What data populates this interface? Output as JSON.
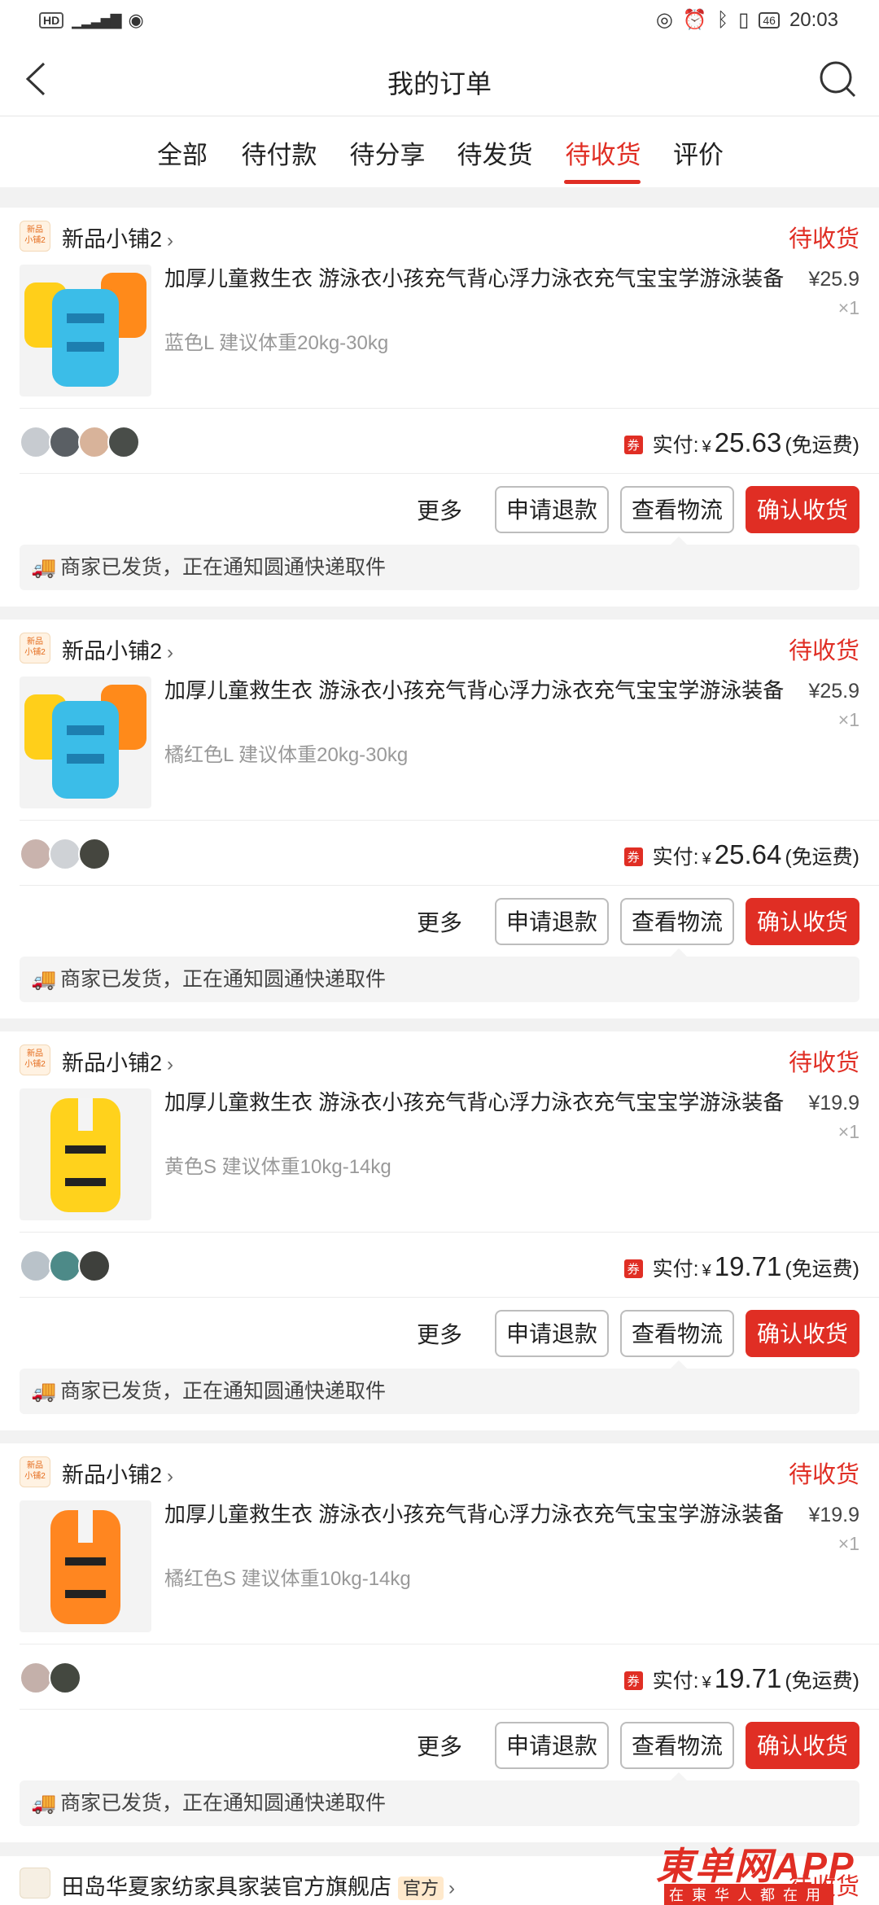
{
  "statusbar": {
    "left": [
      "HD",
      "4G",
      "wifi"
    ],
    "battery": "46",
    "time": "20:03"
  },
  "header": {
    "title": "我的订单"
  },
  "tabs": [
    {
      "label": "全部"
    },
    {
      "label": "待付款"
    },
    {
      "label": "待分享"
    },
    {
      "label": "待发货"
    },
    {
      "label": "待收货",
      "active": true
    },
    {
      "label": "评价"
    }
  ],
  "orders": [
    {
      "shop": "新品小铺2",
      "shop_icon_text": "新品小铺2",
      "status": "待收货",
      "product": "加厚儿童救生衣 游泳衣小孩充气背心浮力泳衣充气宝宝学游泳装备",
      "spec": "蓝色L 建议体重20kg-30kg",
      "price": "¥25.9",
      "qty": "×1",
      "paid_label": "实付:",
      "coupon": "券",
      "currency": "¥",
      "amount": "25.63",
      "shipping": "(免运费)",
      "more": "更多",
      "btn_refund": "申请退款",
      "btn_logistics": "查看物流",
      "btn_confirm": "确认收货",
      "notice": "商家已发货，正在通知圆通快递取件"
    },
    {
      "shop": "新品小铺2",
      "shop_icon_text": "新品小铺2",
      "status": "待收货",
      "product": "加厚儿童救生衣 游泳衣小孩充气背心浮力泳衣充气宝宝学游泳装备",
      "spec": "橘红色L 建议体重20kg-30kg",
      "price": "¥25.9",
      "qty": "×1",
      "paid_label": "实付:",
      "coupon": "券",
      "currency": "¥",
      "amount": "25.64",
      "shipping": "(免运费)",
      "more": "更多",
      "btn_refund": "申请退款",
      "btn_logistics": "查看物流",
      "btn_confirm": "确认收货",
      "notice": "商家已发货，正在通知圆通快递取件"
    },
    {
      "shop": "新品小铺2",
      "shop_icon_text": "新品小铺2",
      "status": "待收货",
      "product": "加厚儿童救生衣 游泳衣小孩充气背心浮力泳衣充气宝宝学游泳装备",
      "spec": "黄色S 建议体重10kg-14kg",
      "price": "¥19.9",
      "qty": "×1",
      "paid_label": "实付:",
      "coupon": "券",
      "currency": "¥",
      "amount": "19.71",
      "shipping": "(免运费)",
      "more": "更多",
      "btn_refund": "申请退款",
      "btn_logistics": "查看物流",
      "btn_confirm": "确认收货",
      "notice": "商家已发货，正在通知圆通快递取件"
    },
    {
      "shop": "新品小铺2",
      "shop_icon_text": "新品小铺2",
      "status": "待收货",
      "product": "加厚儿童救生衣 游泳衣小孩充气背心浮力泳衣充气宝宝学游泳装备",
      "spec": "橘红色S 建议体重10kg-14kg",
      "price": "¥19.9",
      "qty": "×1",
      "paid_label": "实付:",
      "coupon": "券",
      "currency": "¥",
      "amount": "19.71",
      "shipping": "(免运费)",
      "more": "更多",
      "btn_refund": "申请退款",
      "btn_logistics": "查看物流",
      "btn_confirm": "确认收货",
      "notice": "商家已发货，正在通知圆通快递取件"
    }
  ],
  "last_shop": {
    "name": "田岛华夏家纺家具家装官方旗舰店",
    "badge": "官方",
    "status": "待收货"
  },
  "watermark": {
    "main": "東单网APP",
    "sub": "在東华人都在用"
  },
  "colors": {
    "accent": "#e02e24"
  }
}
